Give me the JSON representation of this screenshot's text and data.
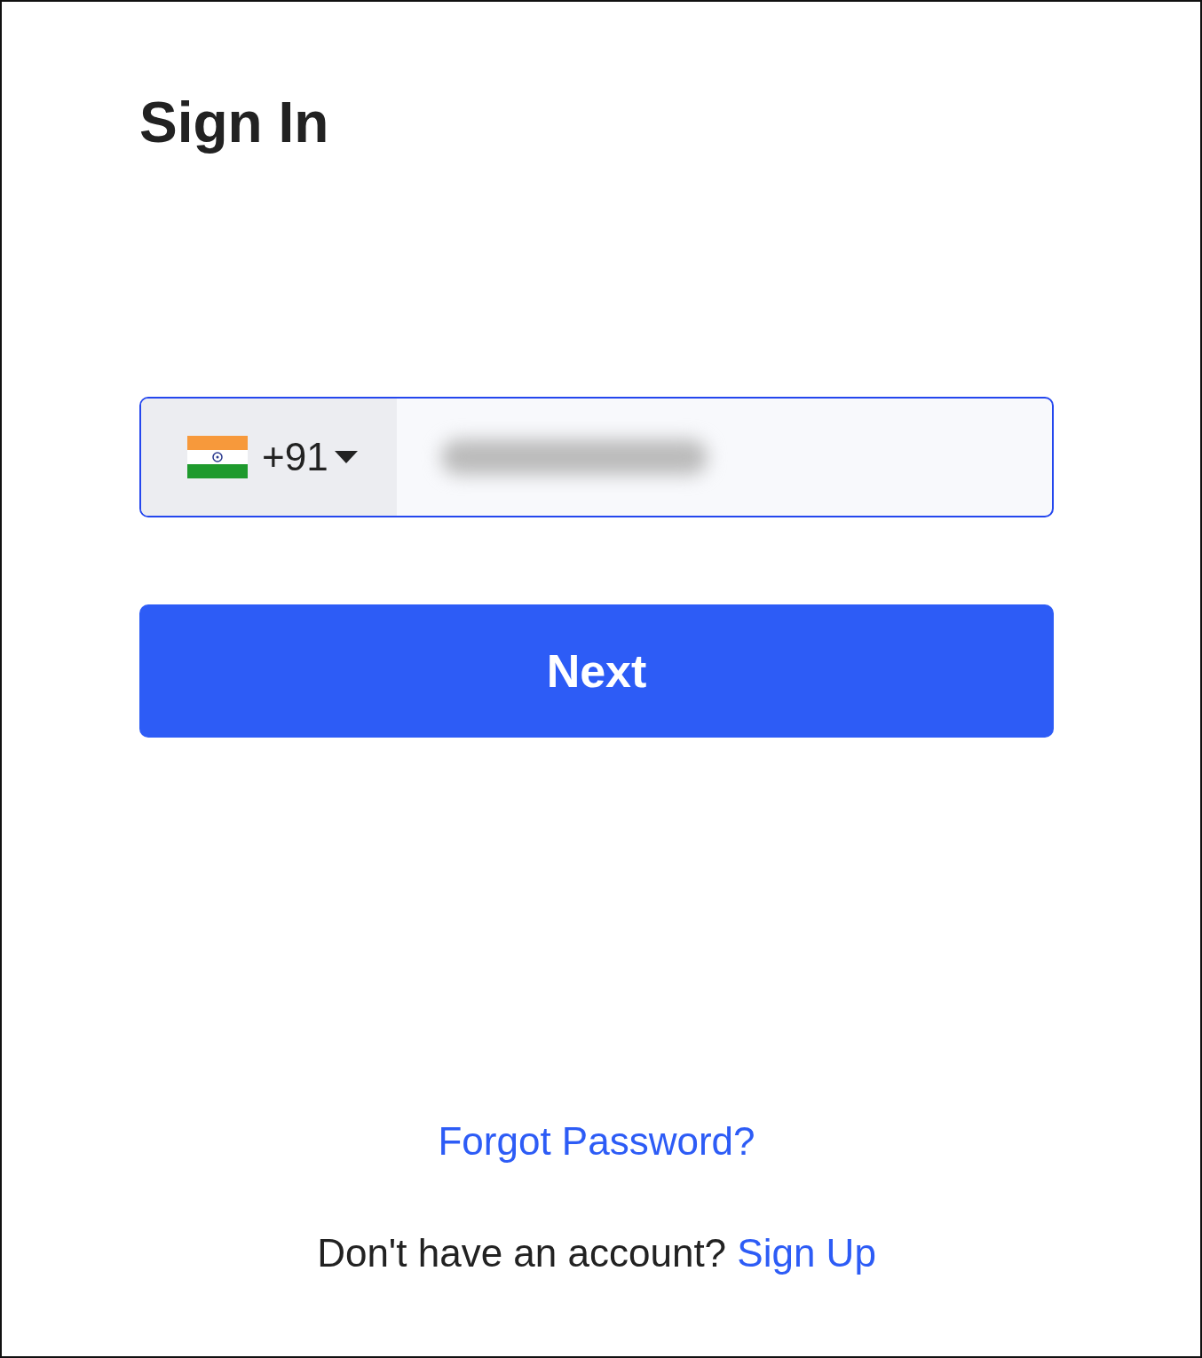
{
  "title": "Sign In",
  "phone": {
    "country_code": "+91",
    "focused": true
  },
  "next_button": "Next",
  "forgot_password": "Forgot Password?",
  "signup": {
    "prompt": "Don't have an account?",
    "link": "Sign Up"
  }
}
